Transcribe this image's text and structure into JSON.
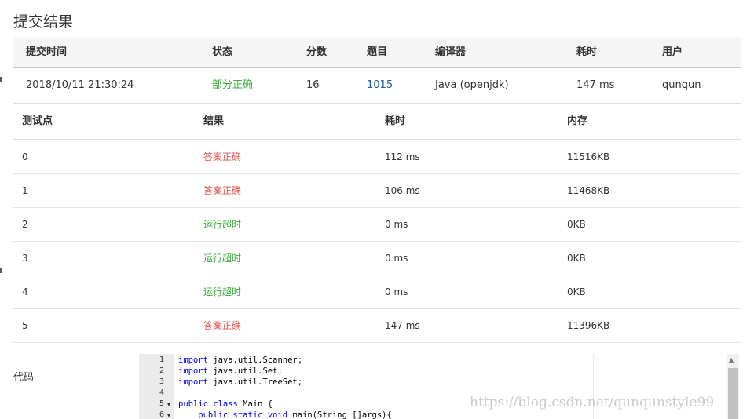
{
  "page_title": "提交结果",
  "summary": {
    "headers": [
      "提交时间",
      "状态",
      "分数",
      "题目",
      "编译器",
      "耗时",
      "用户"
    ],
    "row": {
      "time": "2018/10/11 21:30:24",
      "status": "部分正确",
      "score": "16",
      "problem": "1015",
      "compiler": "Java (openjdk)",
      "elapsed": "147 ms",
      "user": "qunqun"
    }
  },
  "cases": {
    "headers": [
      "测试点",
      "结果",
      "耗时",
      "内存"
    ],
    "rows": [
      {
        "id": "0",
        "result": "答案正确",
        "time": "112 ms",
        "memory": "11516KB"
      },
      {
        "id": "1",
        "result": "答案正确",
        "time": "106 ms",
        "memory": "11468KB"
      },
      {
        "id": "2",
        "result": "运行超时",
        "time": "0 ms",
        "memory": "0KB"
      },
      {
        "id": "3",
        "result": "运行超时",
        "time": "0 ms",
        "memory": "0KB"
      },
      {
        "id": "4",
        "result": "运行超时",
        "time": "0 ms",
        "memory": "0KB"
      },
      {
        "id": "5",
        "result": "答案正确",
        "time": "147 ms",
        "memory": "11396KB"
      }
    ]
  },
  "code_label": "代码",
  "code_lines": [
    {
      "n": "1",
      "kw": "import",
      "rest": " java.util.Scanner;"
    },
    {
      "n": "2",
      "kw": "import",
      "rest": " java.util.Set;"
    },
    {
      "n": "3",
      "kw": "import",
      "rest": " java.util.TreeSet;"
    },
    {
      "n": "4",
      "kw": "",
      "rest": ""
    },
    {
      "n": "5",
      "kw": "public class",
      "rest": " Main {"
    },
    {
      "n": "6",
      "kw": "    public static void",
      "rest": " main(String []args){"
    }
  ],
  "colors": {
    "accepted": "#d9534f",
    "timeout": "#3cab3c",
    "partial": "#3cab3c",
    "link": "#1e5a9c"
  },
  "watermark": "https://blog.csdn.net/qunqunstyle99"
}
